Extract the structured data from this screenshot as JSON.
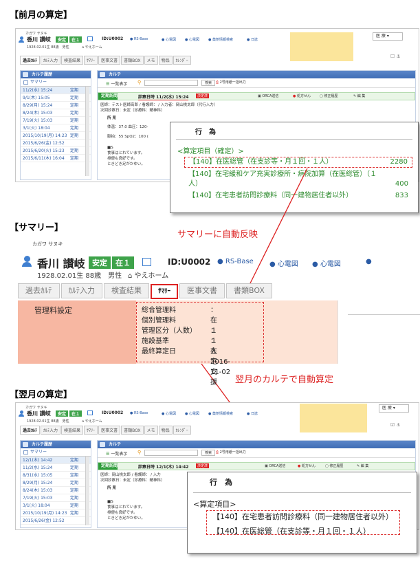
{
  "sections": {
    "prev": "【前月の算定】",
    "summary": "【サマリー】",
    "next": "【翌月の算定】"
  },
  "annotations": {
    "auto_reflect": "サマリーに自動反映",
    "auto_calc": "翌月のカルテで自動算定"
  },
  "patient": {
    "kana": "カガワ サヌキ",
    "name": "香川 讃岐",
    "badge1": "安定",
    "badge2": "在１",
    "id": "ID:U0002",
    "birth": "1928.02.01生 88歳　男性",
    "facility": "やえホーム",
    "rs_base": "RS-Base",
    "shindenzu": "心電図",
    "yakuzai": "薬剤情報検索",
    "nikki": "日誌"
  },
  "right_panel": {
    "dept": "医 療"
  },
  "tabs": [
    "過去ｶﾙﾃ",
    "ｶﾙﾃ入力",
    "検査結果",
    "ｻﾏﾘｰ",
    "医事文書",
    "書類BOX",
    "メモ",
    "物品",
    "ｶﾚﾝﾀﾞｰ"
  ],
  "tabs_large": [
    "過去ｶﾙﾃ",
    "ｶﾙﾃ入力",
    "検査結果",
    "ｻﾏﾘｰ",
    "医事文書",
    "書類BOX"
  ],
  "history_panel": {
    "title": "カルテ履歴",
    "summary": "サマリー"
  },
  "karte_panel": {
    "title": "カルテ",
    "list_btn": "一覧表示",
    "search_btn": "検索",
    "print_btn": "2号用紙一括出力"
  },
  "prev_history": [
    {
      "date": "11/2(水) 15:24",
      "kind": "定期"
    },
    {
      "date": "9/1(木) 15:05",
      "kind": "定期"
    },
    {
      "date": "8/29(月) 15:24",
      "kind": "定期"
    },
    {
      "date": "8/24(木) 15:03",
      "kind": "定期"
    },
    {
      "date": "7/19(火) 15:03",
      "kind": "定期"
    },
    {
      "date": "3/1(火) 18:04",
      "kind": "定期"
    },
    {
      "date": "2015/10/19(月) 14:23",
      "kind": "定期"
    },
    {
      "date": "2015/6/26(金) 12:52",
      "kind": ""
    },
    {
      "date": "2015/6/20(火) 15:23",
      "kind": "定期"
    },
    {
      "date": "2015/6/11(木) 16:04",
      "kind": "定期"
    }
  ],
  "next_history": [
    {
      "date": "12/1(木) 14:42",
      "kind": "定期"
    },
    {
      "date": "11/2(水) 15:24",
      "kind": "定期"
    },
    {
      "date": "8/31(水) 15:05",
      "kind": "定期"
    },
    {
      "date": "8/29(月) 15:24",
      "kind": "定期"
    },
    {
      "date": "8/24(木) 15:03",
      "kind": "定期"
    },
    {
      "date": "7/19(火) 15:03",
      "kind": "定期"
    },
    {
      "date": "3/1(火) 18:04",
      "kind": "定期"
    },
    {
      "date": "2015/10/19(月) 14:23",
      "kind": "定期"
    },
    {
      "date": "2015/6/26(金) 12:52",
      "kind": ""
    }
  ],
  "prev_karte": {
    "visit": "定期訪問",
    "date": "診察日時 11/2(水) 15:24",
    "badge": "決定済",
    "orca": "ORCA送信",
    "rx": "処方せん",
    "fix": "修正履歴",
    "edit": "編 集",
    "line1": "医師：テスト医師高郎 / 看護師： / 入力者：岡山桃太郎（代行入力）",
    "line2": "次回診察日：未定（診療科：精神科）",
    "shoken": "所 見",
    "vitals1": "体温：37.0 血圧：120-",
    "vitals2": "脈拍：55 SpO2：100 (",
    "s": "■S",
    "s1": "食事はとれています。",
    "s2": "排便も良好です。",
    "s3": "ときどき足がかゆい。"
  },
  "next_karte": {
    "visit": "定期訪問",
    "date": "診察日時 12/1(木) 14:42",
    "badge": "決定済",
    "orca": "ORCA送信",
    "rx": "処方せん",
    "fix": "修正履歴",
    "edit": "編 集",
    "line1": "医師：岡山桃太郎 / 看護師： / 入力",
    "line2": "次回診察日：未定（診療科：精神科）",
    "shoken": "所 見",
    "s": "■S",
    "s1": "食事はとれています。",
    "s2": "排便も良好です。",
    "s3": "ときどき足がかゆい。"
  },
  "prev_popup": {
    "title": "行　為",
    "header": "<算定項目（確定）>",
    "items": [
      {
        "name": "【140】在医総管（在支診等・月１回・１人）",
        "points": "2280"
      },
      {
        "name": "【140】在宅緩和ケア充実診療所・病院加算（在医総管）（１人）",
        "points": "400"
      },
      {
        "name": "【140】在宅患者訪問診療料（同一建物居住者以外）",
        "points": "833"
      }
    ]
  },
  "next_popup": {
    "title": "行　為",
    "header": "<算定項目>",
    "items": [
      {
        "name": "【140】在宅患者訪問診療料（同一建物居住者以外）"
      },
      {
        "name": "【140】在医総管（在支診等・月１回・１人）"
      }
    ]
  },
  "summary": {
    "label": "管理料設定",
    "rows": [
      {
        "k": "総合管理料",
        "v": "：在１"
      },
      {
        "k": "個別管理料",
        "v": "："
      },
      {
        "k": "管理区分（人数）",
        "v": "：１人"
      },
      {
        "k": "施設基準",
        "v": "：在宅支援"
      },
      {
        "k": "最終算定日",
        "v": "：2016-11-02"
      }
    ]
  },
  "colors": {
    "accent_red": "#d22",
    "green": "#2e9c3a",
    "blue": "#3f6db5",
    "summary_bg": "#f7b7a2"
  }
}
